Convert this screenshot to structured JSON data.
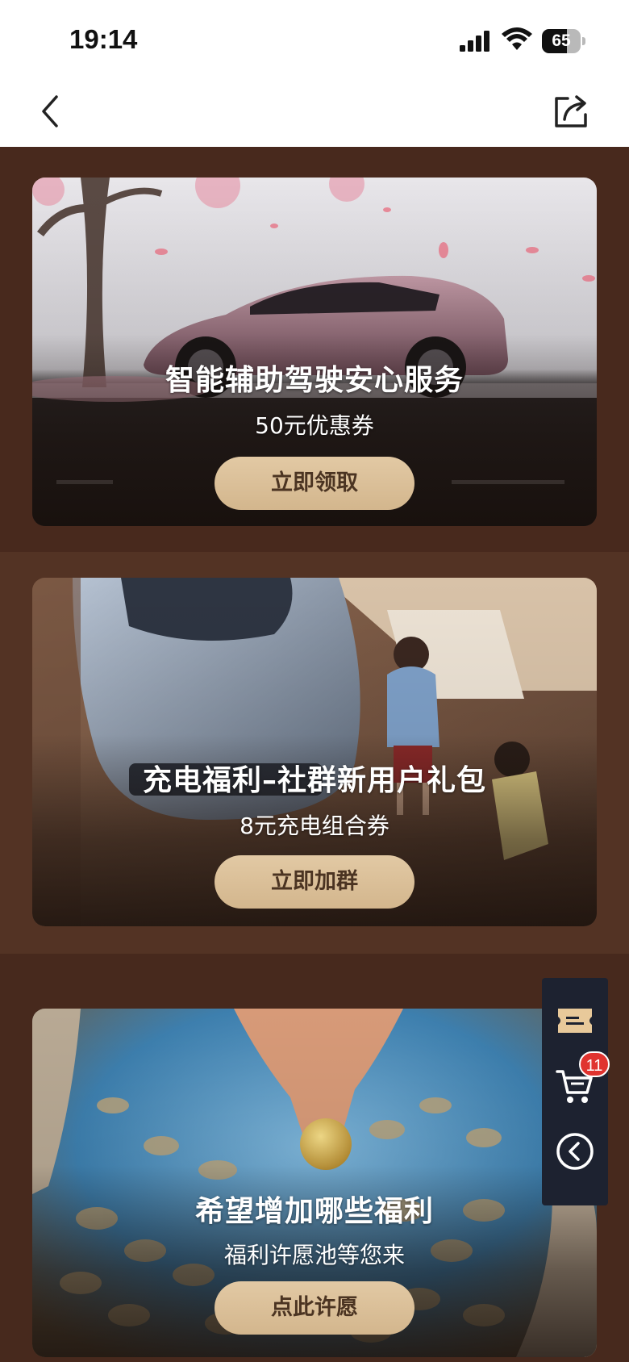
{
  "status_bar": {
    "time": "19:14",
    "battery": "65",
    "battery_level": 0.65
  },
  "nav": {
    "back_icon": "chevron-left-icon",
    "share_icon": "share-icon"
  },
  "cards": [
    {
      "title": "智能辅助驾驶安心服务",
      "subtitle": "50元优惠券",
      "button": "立即领取"
    },
    {
      "title": "充电福利–社群新用户礼包",
      "subtitle": "8元充电组合券",
      "button": "立即加群"
    },
    {
      "title": "希望增加哪些福利",
      "subtitle": "福利许愿池等您来",
      "button": "点此许愿"
    }
  ],
  "side_panel": {
    "items": [
      "coupon-icon",
      "cart-icon",
      "back-circle-icon"
    ],
    "cart_count": "11"
  },
  "colors": {
    "page_bg": "#47291d",
    "button_bg": "#dcc199",
    "button_text": "#4b3422",
    "badge": "#e0332f"
  }
}
